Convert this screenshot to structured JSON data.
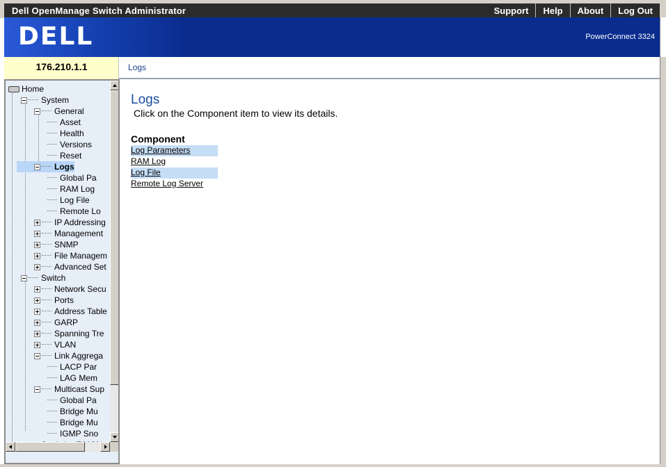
{
  "app_title": "Dell OpenManage Switch Administrator",
  "top_links": [
    "Support",
    "Help",
    "About",
    "Log Out"
  ],
  "logo_text": "DELL",
  "model": "PowerConnect 3324",
  "ip": "176.210.1.1",
  "breadcrumb": "Logs",
  "tree": [
    {
      "label": "Home",
      "depth": 0,
      "icon": "home-icon"
    },
    {
      "label": "System",
      "depth": 1,
      "toggle": "minus"
    },
    {
      "label": "General",
      "depth": 2,
      "toggle": "minus"
    },
    {
      "label": "Asset",
      "depth": 3
    },
    {
      "label": "Health",
      "depth": 3
    },
    {
      "label": "Versions",
      "depth": 3
    },
    {
      "label": "Reset",
      "depth": 3
    },
    {
      "label": "Logs",
      "depth": 2,
      "toggle": "minus",
      "selected": true
    },
    {
      "label": "Global Pa",
      "depth": 3
    },
    {
      "label": "RAM Log",
      "depth": 3
    },
    {
      "label": "Log File",
      "depth": 3
    },
    {
      "label": "Remote Lo",
      "depth": 3
    },
    {
      "label": "IP Addressing",
      "depth": 2,
      "toggle": "plus"
    },
    {
      "label": "Management",
      "depth": 2,
      "toggle": "plus"
    },
    {
      "label": "SNMP",
      "depth": 2,
      "toggle": "plus"
    },
    {
      "label": "File Managem",
      "depth": 2,
      "toggle": "plus"
    },
    {
      "label": "Advanced Set",
      "depth": 2,
      "toggle": "plus"
    },
    {
      "label": "Switch",
      "depth": 1,
      "toggle": "minus"
    },
    {
      "label": "Network Secu",
      "depth": 2,
      "toggle": "plus"
    },
    {
      "label": "Ports",
      "depth": 2,
      "toggle": "plus"
    },
    {
      "label": "Address Table",
      "depth": 2,
      "toggle": "plus"
    },
    {
      "label": "GARP",
      "depth": 2,
      "toggle": "plus"
    },
    {
      "label": "Spanning Tre",
      "depth": 2,
      "toggle": "plus"
    },
    {
      "label": "VLAN",
      "depth": 2,
      "toggle": "plus"
    },
    {
      "label": "Link Aggrega",
      "depth": 2,
      "toggle": "minus"
    },
    {
      "label": "LACP Par",
      "depth": 3
    },
    {
      "label": "LAG Mem",
      "depth": 3
    },
    {
      "label": "Multicast Sup",
      "depth": 2,
      "toggle": "minus"
    },
    {
      "label": "Global Pa",
      "depth": 3
    },
    {
      "label": "Bridge Mu",
      "depth": 3
    },
    {
      "label": "Bridge Mu",
      "depth": 3
    },
    {
      "label": "IGMP Sno",
      "depth": 3
    },
    {
      "label": "Statistics/RMON",
      "depth": 1,
      "toggle": "minus"
    }
  ],
  "content": {
    "title": "Logs",
    "subtitle": "Click on the Component item to view its details.",
    "component_heading": "Component",
    "components": [
      "Log Parameters",
      "RAM Log",
      "Log File",
      "Remote Log Server"
    ]
  }
}
